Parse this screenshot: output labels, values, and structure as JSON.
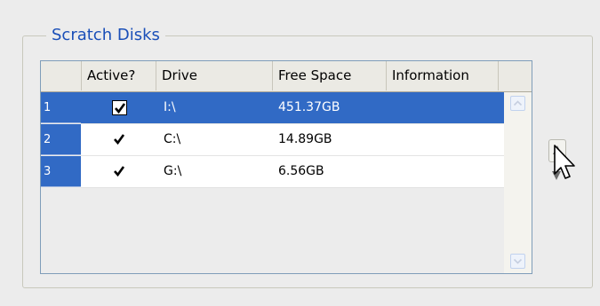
{
  "group": {
    "title": "Scratch Disks"
  },
  "table": {
    "headers": {
      "active": "Active?",
      "drive": "Drive",
      "free_space": "Free Space",
      "information": "Information"
    },
    "rows": [
      {
        "index": "1",
        "active": true,
        "drive": "I:\\",
        "free_space": "451.37GB",
        "information": ""
      },
      {
        "index": "2",
        "active": true,
        "drive": "C:\\",
        "free_space": "14.89GB",
        "information": ""
      },
      {
        "index": "3",
        "active": true,
        "drive": "G:\\",
        "free_space": "6.56GB",
        "information": ""
      }
    ],
    "selected_row": 1
  },
  "colors": {
    "selection": "#316ac5",
    "legend": "#1a4fb8"
  },
  "icons": {
    "scroll_up": "chevron-up-icon",
    "scroll_down": "chevron-down-icon",
    "move_up": "triangle-up-icon",
    "move_down": "triangle-down-icon",
    "cursor": "mouse-pointer-icon"
  }
}
